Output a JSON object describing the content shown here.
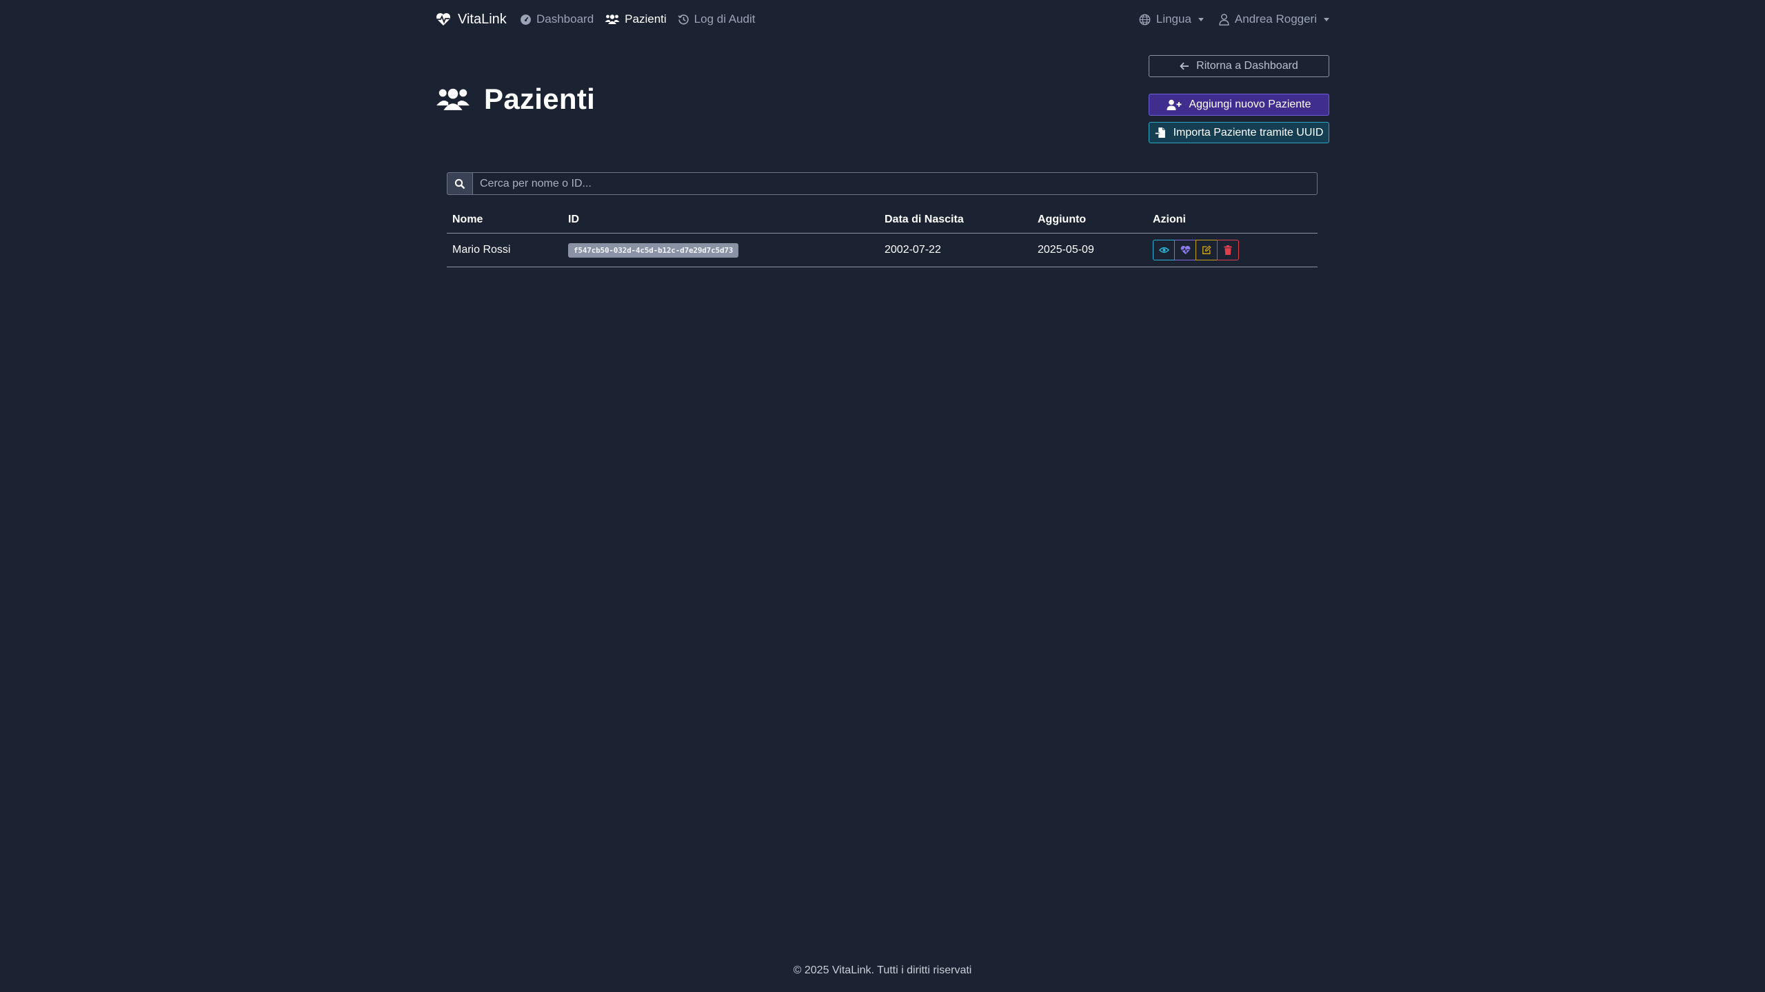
{
  "brand": {
    "name": "VitaLink"
  },
  "nav": {
    "links": [
      {
        "label": "Dashboard",
        "icon": "dashboard-icon",
        "active": false
      },
      {
        "label": "Pazienti",
        "icon": "users-icon",
        "active": true
      },
      {
        "label": "Log di Audit",
        "icon": "history-icon",
        "active": false
      }
    ],
    "language_label": "Lingua",
    "user_name": "Andrea Roggeri"
  },
  "header": {
    "title": "Pazienti",
    "back_button": "Ritorna a Dashboard",
    "add_button": "Aggiungi nuovo Paziente",
    "import_button": "Importa Paziente tramite UUID"
  },
  "search": {
    "placeholder": "Cerca per nome o ID..."
  },
  "table": {
    "columns": [
      "Nome",
      "ID",
      "Data di Nascita",
      "Aggiunto",
      "Azioni"
    ],
    "rows": [
      {
        "name": "Mario Rossi",
        "id": "f547cb50-032d-4c5d-b12c-d7e29d7c5d73",
        "birth_date": "2002-07-22",
        "added": "2025-05-09",
        "actions": [
          "eye-icon",
          "heart-pulse-icon",
          "edit-icon",
          "trash-icon"
        ]
      }
    ]
  },
  "footer": {
    "text": "© 2025 VitaLink. Tutti i diritti riservati"
  },
  "colors": {
    "background": "#1b2232",
    "primary_purple": "#3f2e8e",
    "info_teal": "#163e52",
    "danger": "#e0404e",
    "warning": "#c8a21a"
  }
}
